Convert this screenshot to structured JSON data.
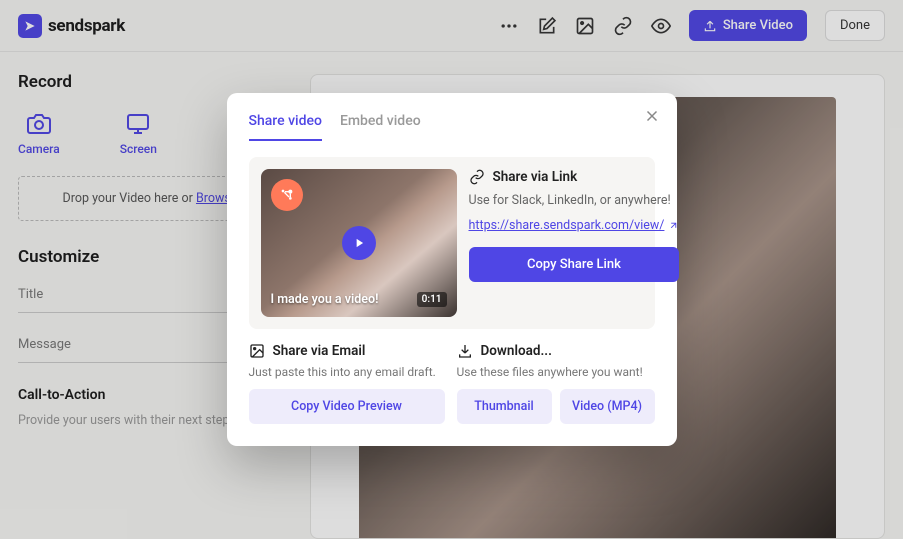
{
  "header": {
    "logo_text": "sendspark",
    "share_button": "Share Video",
    "done_button": "Done"
  },
  "sidebar": {
    "record_heading": "Record",
    "camera_label": "Camera",
    "screen_label": "Screen",
    "dropzone_prefix": "Drop your Video here or ",
    "dropzone_link": "Browse",
    "customize_heading": "Customize",
    "title_label": "Title",
    "message_label": "Message",
    "cta_heading": "Call-to-Action",
    "cta_help": "Provide your users with their next steps."
  },
  "modal": {
    "tab_share": "Share video",
    "tab_embed": "Embed video",
    "thumb_caption": "I made you a video!",
    "thumb_duration": "0:11",
    "share_link_heading": "Share via Link",
    "share_link_desc": "Use for Slack, LinkedIn, or anywhere!",
    "share_link_url": "https://share.sendspark.com/view/",
    "copy_share_link": "Copy Share Link",
    "email_heading": "Share via Email",
    "email_desc": "Just paste this into any email draft.",
    "copy_preview": "Copy Video Preview",
    "download_heading": "Download...",
    "download_desc": "Use these files anywhere you want!",
    "thumbnail_btn": "Thumbnail",
    "mp4_btn": "Video (MP4)"
  }
}
